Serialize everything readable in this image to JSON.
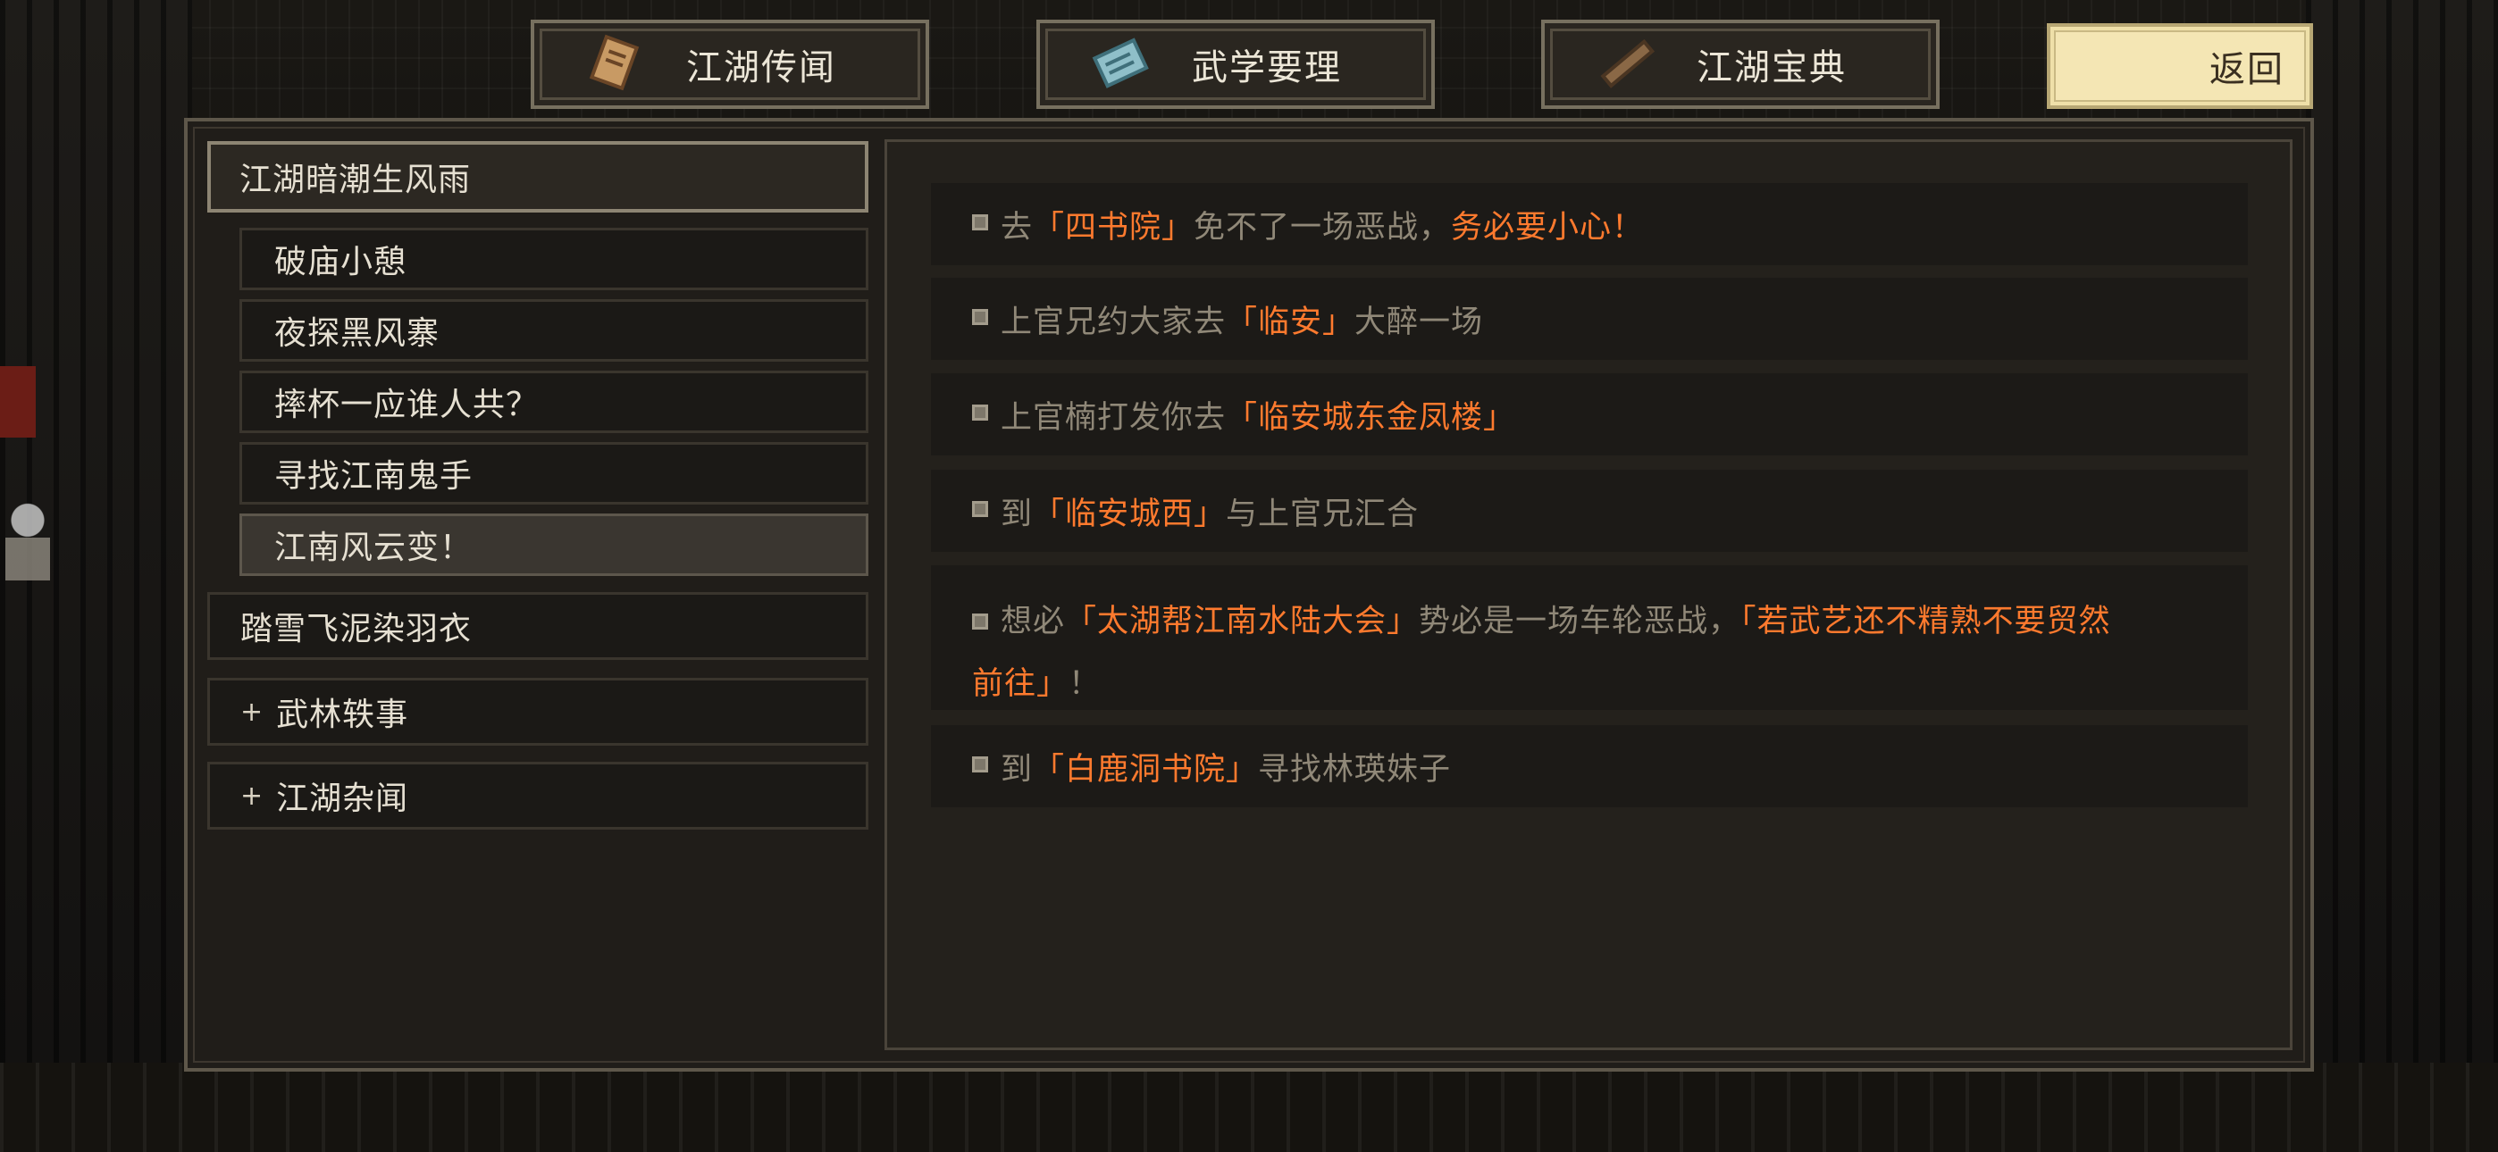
{
  "tabs": [
    {
      "label": "江湖传闻",
      "icon": "scroll-icon"
    },
    {
      "label": "武学要理",
      "icon": "manual-icon"
    },
    {
      "label": "江湖宝典",
      "icon": "book-roll-icon"
    }
  ],
  "back_label": "返回",
  "sidebar": {
    "header": "江湖暗潮生风雨",
    "sub_items": [
      "破庙小憩",
      "夜探黑风寨",
      "摔杯一应谁人共？",
      "寻找江南鬼手",
      "江南风云变！"
    ],
    "selected_sub": "江南风云变！",
    "top_items": [
      "踏雪飞泥染羽衣"
    ],
    "collapsed_items": [
      {
        "plus": "+",
        "label": "武林轶事"
      },
      {
        "plus": "+",
        "label": "江湖杂闻"
      }
    ]
  },
  "colors": {
    "highlight": "#ff7a2e",
    "text_dim": "#908878",
    "panel": "#201d19",
    "back_button": "#f4e6b4"
  },
  "entries": [
    {
      "parts": [
        {
          "t": "去",
          "hl": false
        },
        {
          "t": "「四书院」",
          "hl": true
        },
        {
          "t": "免不了一场恶战，",
          "hl": false
        },
        {
          "t": "务必要小心！",
          "hl": true
        }
      ]
    },
    {
      "parts": [
        {
          "t": "上官兄约大家去",
          "hl": false
        },
        {
          "t": "「临安」",
          "hl": true
        },
        {
          "t": "大醉一场",
          "hl": false
        }
      ]
    },
    {
      "parts": [
        {
          "t": "上官楠打发你去",
          "hl": false
        },
        {
          "t": "「临安城东金凤楼」",
          "hl": true
        }
      ]
    },
    {
      "parts": [
        {
          "t": "到",
          "hl": false
        },
        {
          "t": "「临安城西」",
          "hl": true
        },
        {
          "t": "与上官兄汇合",
          "hl": false
        }
      ]
    },
    {
      "line1": [
        {
          "t": "想必",
          "hl": false
        },
        {
          "t": "「太湖帮江南水陆大会」",
          "hl": true
        },
        {
          "t": "势必是一场车轮恶战，",
          "hl": false
        },
        {
          "t": "「若武艺还不精熟不要贸然",
          "hl": true
        }
      ],
      "line2": [
        {
          "t": "前往」",
          "hl": true
        },
        {
          "t": "！",
          "hl": false
        }
      ]
    },
    {
      "parts": [
        {
          "t": "到",
          "hl": false
        },
        {
          "t": "「白鹿洞书院」",
          "hl": true
        },
        {
          "t": "寻找林瑛妹子",
          "hl": false
        }
      ]
    }
  ]
}
